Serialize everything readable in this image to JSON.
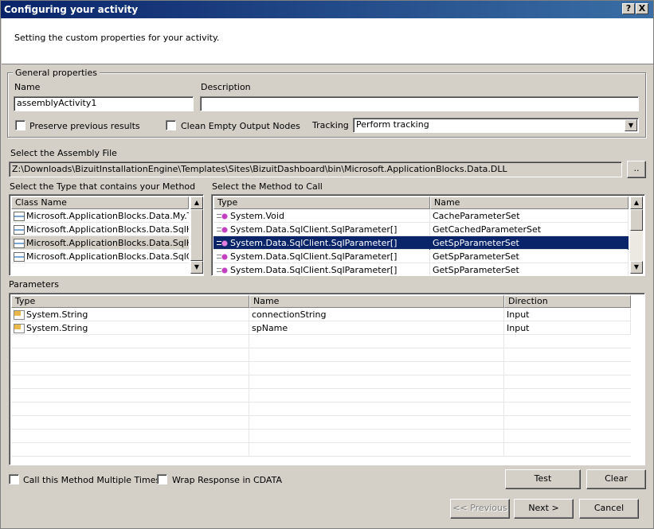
{
  "window": {
    "title": "Configuring your activity",
    "help_btn": "?",
    "close_btn": "X"
  },
  "header": {
    "text": "Setting the custom properties for your activity."
  },
  "general": {
    "legend": "General properties",
    "name_label": "Name",
    "name_value": "assemblyActivity1",
    "description_label": "Description",
    "description_value": "",
    "preserve_label": "Preserve previous results",
    "clean_label": "Clean Empty Output Nodes",
    "tracking_label": "Tracking",
    "tracking_value": "Perform tracking"
  },
  "assembly": {
    "label": "Select the Assembly File",
    "path": "Z:\\Downloads\\BizuitInstallationEngine\\Templates\\Sites\\BizuitDashboard\\bin\\Microsoft.ApplicationBlocks.Data.DLL",
    "browse_label": ".."
  },
  "types": {
    "label": "Select the Type that contains your Method",
    "column": "Class Name",
    "rows": [
      "Microsoft.ApplicationBlocks.Data.My.T...",
      "Microsoft.ApplicationBlocks.Data.SqlHe...",
      "Microsoft.ApplicationBlocks.Data.SqlHe...",
      "Microsoft.ApplicationBlocks.Data.SqlCo..."
    ]
  },
  "methods": {
    "label": "Select the Method to Call",
    "columns": [
      "Type",
      "Name"
    ],
    "rows": [
      {
        "type": "System.Void",
        "name": "CacheParameterSet"
      },
      {
        "type": "System.Data.SqlClient.SqlParameter[]",
        "name": "GetCachedParameterSet"
      },
      {
        "type": "System.Data.SqlClient.SqlParameter[]",
        "name": "GetSpParameterSet"
      },
      {
        "type": "System.Data.SqlClient.SqlParameter[]",
        "name": "GetSpParameterSet"
      },
      {
        "type": "System.Data.SqlClient.SqlParameter[]",
        "name": "GetSpParameterSet"
      }
    ]
  },
  "parameters": {
    "label": "Parameters",
    "columns": [
      "Type",
      "Name",
      "Direction"
    ],
    "rows": [
      {
        "type": "System.String",
        "name": "connectionString",
        "direction": "Input"
      },
      {
        "type": "System.String",
        "name": "spName",
        "direction": "Input"
      }
    ]
  },
  "footer": {
    "multiple_label": "Call this Method Multiple Times",
    "cdata_label": "Wrap Response in CDATA",
    "test_label": "Test",
    "clear_label": "Clear",
    "previous_label": "<< Previous",
    "next_label": "Next >",
    "cancel_label": "Cancel"
  },
  "colors": {
    "title_start": "#0a246a",
    "title_end": "#3a6ea5",
    "selection": "#0a246a",
    "face": "#d4d0c8"
  }
}
